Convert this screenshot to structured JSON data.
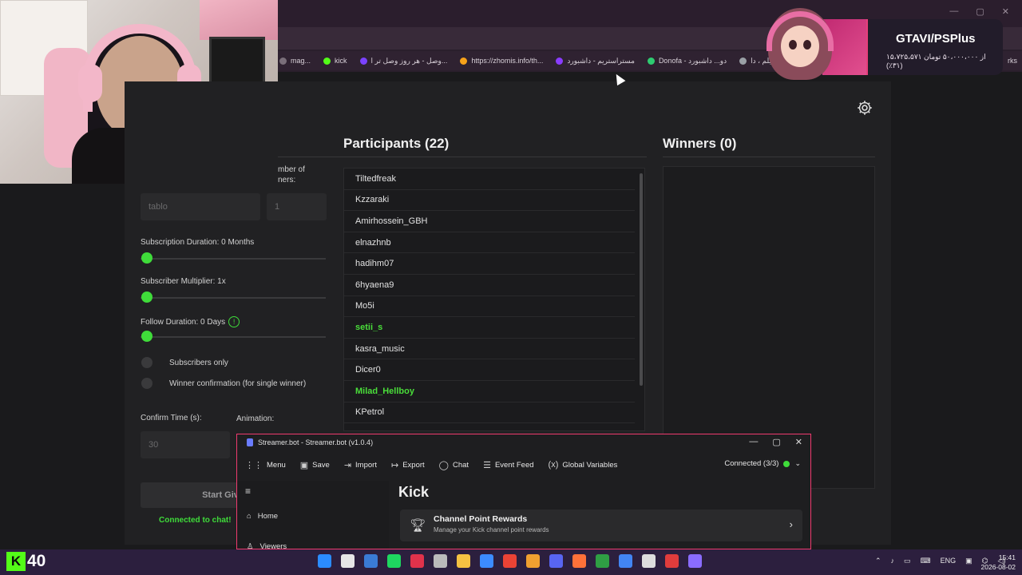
{
  "bookmarks": [
    {
      "label": "mag...",
      "color": "#7a6f7a"
    },
    {
      "label": "kick",
      "color": "#53fc18"
    },
    {
      "label": "وصل - هر روز وصل تر ا...",
      "color": "#7b42ff"
    },
    {
      "label": "https://zhomis.info/th...",
      "color": "#f7a21a"
    },
    {
      "label": "مستراستریم - داشبورد",
      "color": "#8a3cff"
    },
    {
      "label": "Donofa - دو... داشبورد",
      "color": "#2ecc71"
    },
    {
      "label": "دانلود فیلم ، دا...",
      "color": "#9aa0a6"
    }
  ],
  "bookmarks_overflow": "rks",
  "ad": {
    "title": "GTAVI/PSPlus",
    "subtitle": "۱۵،۷۲۵،۵۷۱ از ۵۰،۰۰۰،۰۰۰ تومان (۳۱٪)"
  },
  "participants": {
    "title": "Participants (22)",
    "items": [
      {
        "name": "Tiltedfreak",
        "highlight": false
      },
      {
        "name": "Kzzaraki",
        "highlight": false
      },
      {
        "name": "Amirhossein_GBH",
        "highlight": false
      },
      {
        "name": "elnazhnb",
        "highlight": false
      },
      {
        "name": "hadihm07",
        "highlight": false
      },
      {
        "name": "6hyaena9",
        "highlight": false
      },
      {
        "name": "Mo5i",
        "highlight": false
      },
      {
        "name": "setii_s",
        "highlight": true
      },
      {
        "name": "kasra_music",
        "highlight": false
      },
      {
        "name": "Dicer0",
        "highlight": false
      },
      {
        "name": "Milad_Hellboy",
        "highlight": true
      },
      {
        "name": "KPetrol",
        "highlight": false
      }
    ]
  },
  "winners": {
    "title": "Winners (0)"
  },
  "settings": {
    "number_of_winners_label": "mber of\nners:",
    "keyword_placeholder": "tablo",
    "winners_count": "1",
    "sub_duration_label": "Subscription Duration: 0 Months",
    "sub_multiplier_label": "Subscriber Multiplier: 1x",
    "follow_duration_label": "Follow Duration:  0  Days",
    "subscribers_only_label": "Subscribers only",
    "winner_confirmation_label": "Winner confirmation (for single winner)",
    "confirm_time_label": "Confirm Time (s):",
    "confirm_time_value": "30",
    "animation_label": "Animation:",
    "start_button": "Start Giv",
    "connected_text": "Connected to chat!"
  },
  "streamerbot": {
    "window_title": "Streamer.bot - Streamer.bot (v1.0.4)",
    "menu": [
      "Menu",
      "Save",
      "Import",
      "Export",
      "Chat",
      "Event Feed",
      "Global Variables"
    ],
    "connection": "Connected (3/3)",
    "nav": [
      "Home",
      "Viewers"
    ],
    "section_title": "Kick",
    "card_title": "Channel Point Rewards",
    "card_subtitle": "Manage your Kick channel point rewards"
  },
  "taskbar": {
    "kick_number": "40",
    "lang": "ENG",
    "time": "15:41",
    "date": "2026-08-02",
    "icon_colors": [
      "#2b8cff",
      "#e6e6e6",
      "#3a7bd5",
      "#1ed760",
      "#e0324b",
      "#bbbbbb",
      "#f5c242",
      "#3c8cff",
      "#ea4335",
      "#f0a030",
      "#5865f2",
      "#ff7139",
      "#2f9e44",
      "#4285f4",
      "#dddddd",
      "#e03c3c",
      "#8a6cff"
    ]
  }
}
